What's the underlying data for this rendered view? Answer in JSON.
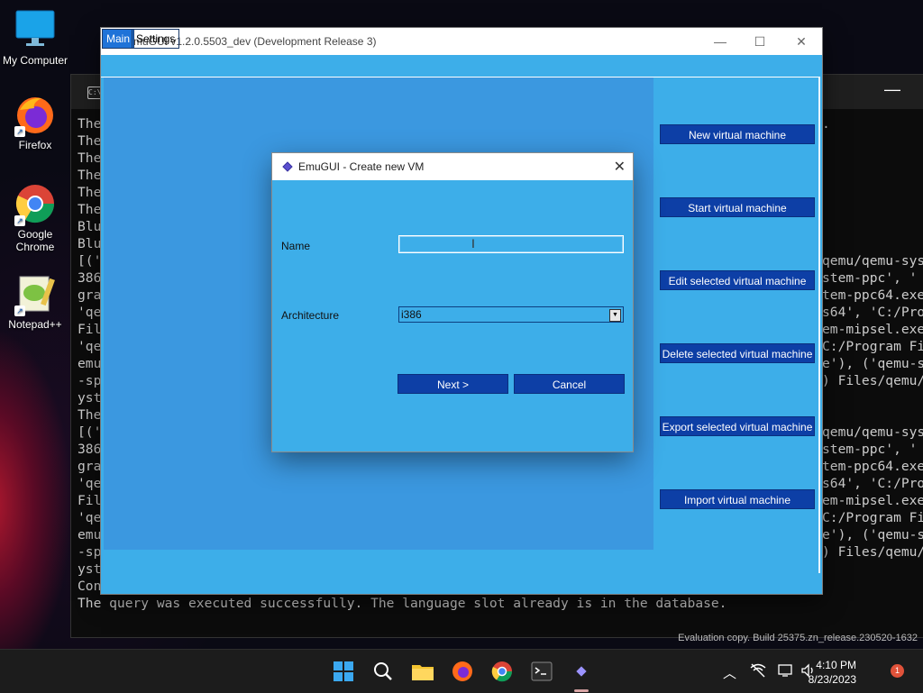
{
  "desktop": {
    "icons": [
      {
        "label": "My Computer"
      },
      {
        "label": "Firefox"
      },
      {
        "label": "Google Chrome"
      },
      {
        "label": "Notepad++"
      }
    ]
  },
  "terminal": {
    "left_lines": [
      "The",
      "The",
      "The",
      "The",
      "The",
      "The",
      "Blu",
      "Blu",
      "[('",
      "386",
      "gra",
      "'qe",
      "Fil",
      "'qe",
      "emu",
      "-sp",
      "yst",
      "The",
      "[('",
      "386",
      "gra",
      "'qe",
      "Fil",
      "'qe",
      "emu",
      "-sp",
      "yst",
      "Con"
    ],
    "right_lines_1": [
      ".",
      "",
      "",
      "",
      "",
      "",
      "",
      "",
      "qemu/qemu-sys",
      "stem-ppc', '",
      "tem-ppc64.exe",
      "s64', 'C:/Pro",
      "em-mipsel.exe",
      "C:/Program Fi",
      "e'), ('qemu-s",
      ") Files/qemu/"
    ],
    "right_lines_2": [
      "qemu/qemu-sys",
      "stem-ppc', '",
      "tem-ppc64.exe",
      "s64', 'C:/Pro",
      "em-mipsel.exe",
      "C:/Program Fi",
      "e'), ('qemu-s",
      ") Files/qemu/"
    ],
    "last_line": "The query was executed successfully. The language slot already is in the database.",
    "watermark": "Evaluation copy. Build 25375.zn_release.230520-1632"
  },
  "emugui": {
    "title": "EmuGUI v1.2.0.5503_dev (Development Release 3)",
    "tabs": [
      {
        "label": "Main"
      },
      {
        "label": "Settings"
      }
    ],
    "side_buttons": [
      {
        "label": "New virtual machine"
      },
      {
        "label": "Start virtual machine"
      },
      {
        "label": "Edit selected virtual machine"
      },
      {
        "label": "Delete selected virtual machine"
      },
      {
        "label": "Export selected virtual machine"
      },
      {
        "label": "Import virtual machine"
      }
    ]
  },
  "dialog": {
    "title": "EmuGUI - Create new VM",
    "name_label": "Name",
    "name_value": "",
    "arch_label": "Architecture",
    "arch_value": "i386",
    "next_label": "Next >",
    "cancel_label": "Cancel"
  },
  "taskbar": {
    "time": "4:10 PM",
    "date": "8/23/2023",
    "notification_count": "1",
    "icons": [
      "windows-start-icon",
      "search-icon",
      "file-explorer-icon",
      "firefox-icon",
      "chrome-icon",
      "terminal-icon",
      "emugui-icon"
    ]
  },
  "colors": {
    "emugui_bg": "#3daee9",
    "button_bg": "#0d3fa6",
    "active_tab": "#1f73d8"
  }
}
